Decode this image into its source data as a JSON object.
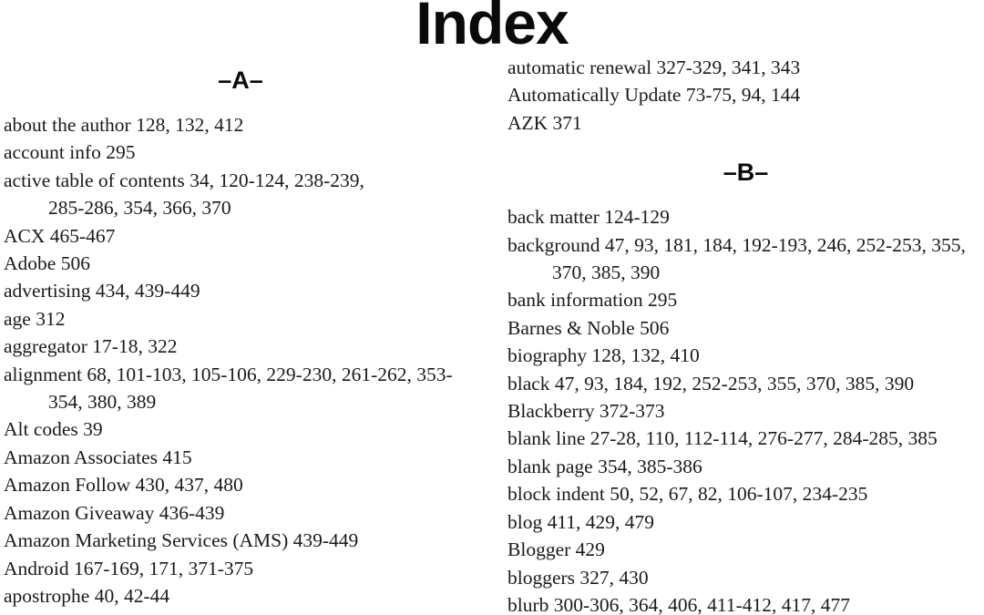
{
  "page": {
    "title": "Index",
    "background_color": "#ffffff",
    "text_color": "#1a1a1a"
  },
  "columns": {
    "left": {
      "divider": "–A–",
      "entries": [
        {
          "text": "about the author 128, 132, 412"
        },
        {
          "text": "account info 295"
        },
        {
          "text": "active table of contents 34, 120-124, 238-239,",
          "continuation": "285-286, 354, 366, 370"
        },
        {
          "text": "ACX 465-467"
        },
        {
          "text": "Adobe 506"
        },
        {
          "text": "advertising 434, 439-449"
        },
        {
          "text": "age 312"
        },
        {
          "text": "aggregator 17-18, 322"
        },
        {
          "text": "alignment 68, 101-103, 105-106, 229-230, 261-262, 353-",
          "continuation": "354, 380, 389"
        },
        {
          "text": "Alt codes 39"
        },
        {
          "text": "Amazon Associates 415"
        },
        {
          "text": "Amazon Follow 430, 437, 480"
        },
        {
          "text": "Amazon Giveaway 436-439"
        },
        {
          "text": "Amazon Marketing Services (AMS) 439-449"
        },
        {
          "text": "Android 167-169, 171, 371-375"
        },
        {
          "text": "apostrophe 40, 42-44"
        }
      ]
    },
    "right": {
      "entries_before_divider": [
        {
          "text": "automatic renewal 327-329, 341, 343"
        },
        {
          "text": "Automatically Update 73-75, 94, 144"
        },
        {
          "text": "AZK 371"
        }
      ],
      "divider": "–B–",
      "entries": [
        {
          "text": "back matter 124-129"
        },
        {
          "text": "background 47, 93, 181, 184, 192-193, 246, 252-253, 355,",
          "continuation": "370, 385, 390"
        },
        {
          "text": "bank information 295"
        },
        {
          "text": "Barnes & Noble 506"
        },
        {
          "text": "biography 128, 132, 410"
        },
        {
          "text": "black 47, 93, 184, 192, 252-253, 355, 370, 385, 390"
        },
        {
          "text": "Blackberry 372-373"
        },
        {
          "text": "blank line 27-28, 110, 112-114, 276-277, 284-285, 385"
        },
        {
          "text": "blank page 354, 385-386"
        },
        {
          "text": "block indent 50, 52, 67, 82, 106-107, 234-235"
        },
        {
          "text": "blog 411, 429, 479"
        },
        {
          "text": "Blogger 429"
        },
        {
          "text": "bloggers 327, 430"
        },
        {
          "text": "blurb 300-306, 364, 406, 411-412, 417, 477"
        }
      ]
    }
  }
}
